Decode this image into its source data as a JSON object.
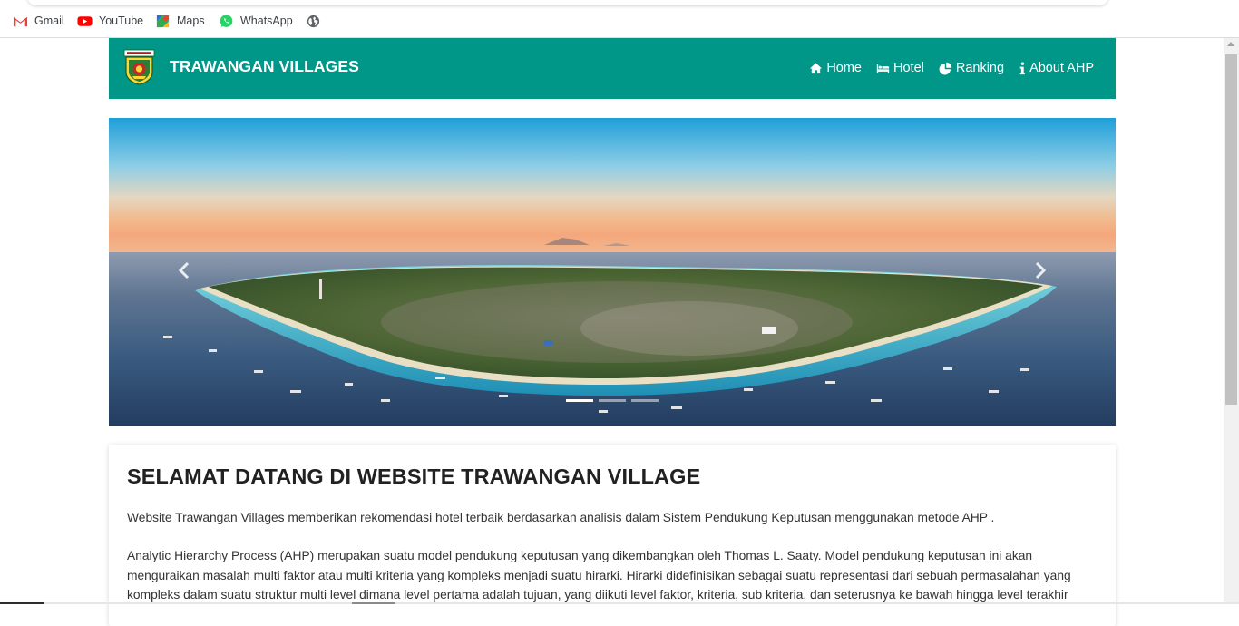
{
  "bookmarks": [
    {
      "label": "Gmail",
      "icon": "gmail-icon"
    },
    {
      "label": "YouTube",
      "icon": "youtube-icon"
    },
    {
      "label": "Maps",
      "icon": "maps-icon"
    },
    {
      "label": "WhatsApp",
      "icon": "whatsapp-icon"
    },
    {
      "label": "",
      "icon": "globe-icon"
    }
  ],
  "site": {
    "brand": "TRAWANGAN VILLAGES",
    "logo_icon": "regency-emblem-icon",
    "accent_color": "#009688"
  },
  "nav": [
    {
      "label": "Home",
      "icon": "home-icon"
    },
    {
      "label": "Hotel",
      "icon": "bed-icon"
    },
    {
      "label": "Ranking",
      "icon": "pie-chart-icon"
    },
    {
      "label": "About AHP",
      "icon": "info-icon"
    }
  ],
  "carousel": {
    "slide_count": 3,
    "active_slide": 1,
    "prev_icon": "chevron-left-icon",
    "next_icon": "chevron-right-icon"
  },
  "welcome": {
    "title": "SELAMAT DATANG DI WEBSITE TRAWANGAN VILLAGE",
    "paragraph1": "Website Trawangan Villages memberikan rekomendasi hotel terbaik berdasarkan analisis dalam Sistem Pendukung Keputusan menggunakan metode AHP .",
    "paragraph2": "Analytic Hierarchy Process (AHP) merupakan suatu model pendukung keputusan yang dikembangkan oleh Thomas L. Saaty. Model pendukung keputusan ini akan menguraikan masalah multi faktor atau multi kriteria yang kompleks menjadi suatu hirarki. Hirarki didefinisikan sebagai suatu representasi dari sebuah permasalahan yang kompleks dalam suatu struktur multi level dimana level pertama adalah tujuan, yang diikuti level faktor, kriteria, sub kriteria, dan seterusnya ke bawah hingga level terakhir"
  }
}
